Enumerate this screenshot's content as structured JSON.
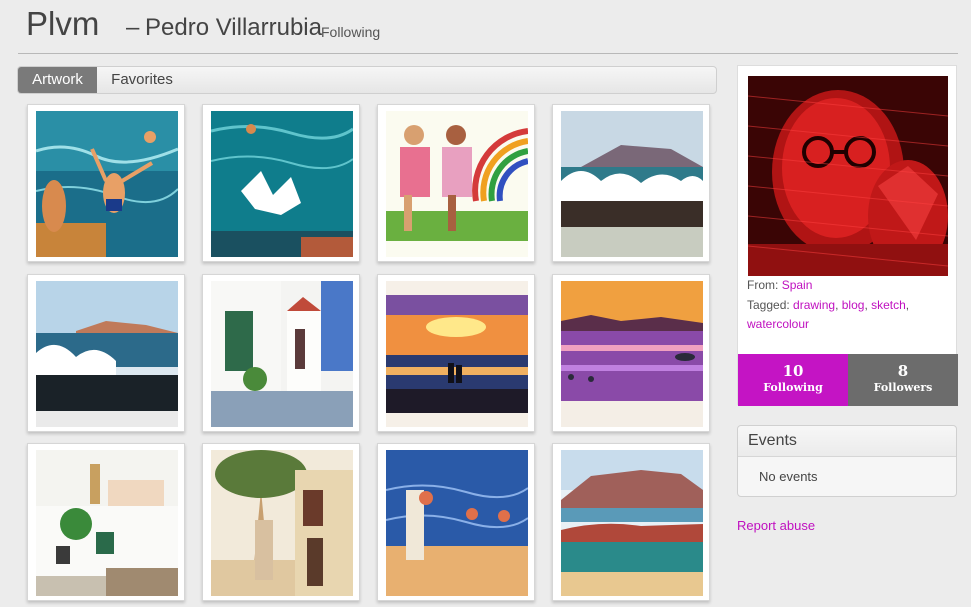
{
  "header": {
    "username": "Plvm",
    "dash": "–",
    "full_name": "Pedro Villarrubia",
    "following_link": "Following"
  },
  "tabs": [
    {
      "label": "Artwork",
      "active": true
    },
    {
      "label": "Favorites",
      "active": false
    }
  ],
  "artworks": [
    {
      "subject": "children jumping into sea"
    },
    {
      "subject": "swimmer splashing in sea"
    },
    {
      "subject": "girls reading under rainbow"
    },
    {
      "subject": "waves on rocks with mountain"
    },
    {
      "subject": "rocky coast waves"
    },
    {
      "subject": "white village street"
    },
    {
      "subject": "sunset over sea with figures"
    },
    {
      "subject": "purple sunset with swimmers"
    },
    {
      "subject": "white houses with tower"
    },
    {
      "subject": "tree lined street"
    },
    {
      "subject": "family bathing at beach"
    },
    {
      "subject": "mountain and rocky shore"
    }
  ],
  "profile": {
    "from_label": "From:",
    "from_value": "Spain",
    "tagged_label": "Tagged:",
    "tags": [
      "drawing",
      "blog",
      "sketch",
      "watercolour"
    ],
    "following_count": "10",
    "following_label": "Following",
    "followers_count": "8",
    "followers_label": "Followers"
  },
  "events": {
    "title": "Events",
    "empty_text": "No events"
  },
  "report_link": "Report abuse",
  "colors": {
    "accent": "#c414c4",
    "link": "#c010c0",
    "followers_bg": "#6c6c6c",
    "tab_active_bg": "#7a7a7a"
  }
}
